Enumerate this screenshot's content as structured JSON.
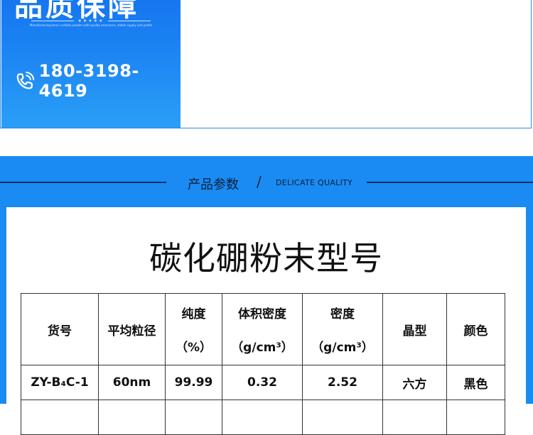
{
  "banner": {
    "title": "品质保障",
    "stars": "★★★★★",
    "tiny_text": "Manufacturing boron carbide powder with quality assurance, stable supply and professional technical support for customers worldwide",
    "phone": "180-3198-4619"
  },
  "section": {
    "title_cn": "产品参数",
    "slash": "/",
    "title_en": "DELICATE QUALITY"
  },
  "card": {
    "title": "碳化硼粉末型号"
  },
  "table": {
    "headers": [
      {
        "line1": "货号"
      },
      {
        "line1": "平均粒径"
      },
      {
        "line1": "纯度",
        "line2": "（%）"
      },
      {
        "line1": "体积密度",
        "line2": "（g/cm³）"
      },
      {
        "line1": "密度",
        "line2": "（g/cm³）"
      },
      {
        "line1": "晶型"
      },
      {
        "line1": "颜色"
      }
    ],
    "rows": [
      [
        "ZY-B₄C-1",
        "60nm",
        "99.99",
        "0.32",
        "2.52",
        "六方",
        "黑色"
      ],
      [
        "",
        "",
        "",
        "",
        "",
        "",
        ""
      ]
    ]
  },
  "colors": {
    "brand_blue": "#1a8bf2",
    "header_line": "#0b2f66"
  },
  "icons": [
    "phone-icon"
  ]
}
